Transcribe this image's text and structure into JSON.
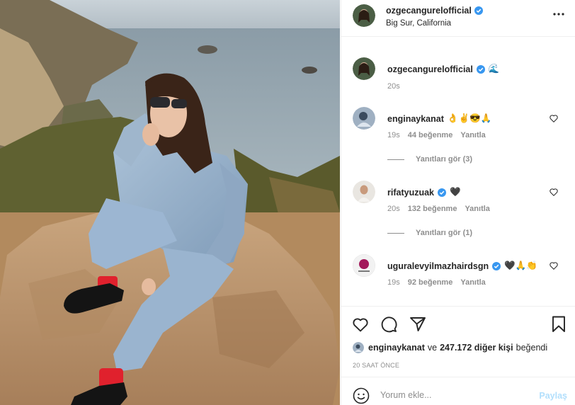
{
  "post": {
    "image_alt": "woman sitting on a rock above the sea",
    "author": {
      "username": "ozgecangurelofficial",
      "verified": true,
      "location": "Big Sur, California"
    },
    "menu_icon": "more-horizontal-icon"
  },
  "comments": [
    {
      "username": "ozgecangurelofficial",
      "verified": true,
      "text": "🌊",
      "time": "20s"
    },
    {
      "username": "enginaykanat",
      "verified": false,
      "text": "👌✌😎🙏",
      "time": "19s",
      "likes": "44 beğenme",
      "reply_label": "Yanıtla",
      "view_replies": "Yanıtları gör (3)"
    },
    {
      "username": "rifatyuzuak",
      "verified": true,
      "text": "🖤",
      "time": "20s",
      "likes": "132 beğenme",
      "reply_label": "Yanıtla",
      "view_replies": "Yanıtları gör (1)"
    },
    {
      "username": "uguralevyilmazhairdsgn",
      "verified": true,
      "text": "🖤🙏👏",
      "time": "19s",
      "likes": "92 beğenme",
      "reply_label": "Yanıtla"
    }
  ],
  "likes_summary": {
    "user": "enginaykanat",
    "connector": "ve",
    "others": "247.172 diğer kişi",
    "suffix": "beğendi"
  },
  "timestamp": "20 SAAT ÖNCE",
  "comment_input": {
    "placeholder": "Yorum ekle...",
    "value": ""
  },
  "post_button": "Paylaş",
  "colors": {
    "verified_blue": "#3897f0",
    "muted_text": "#8e8e8e",
    "post_button_disabled": "#b2dffc",
    "border": "#efefef"
  }
}
